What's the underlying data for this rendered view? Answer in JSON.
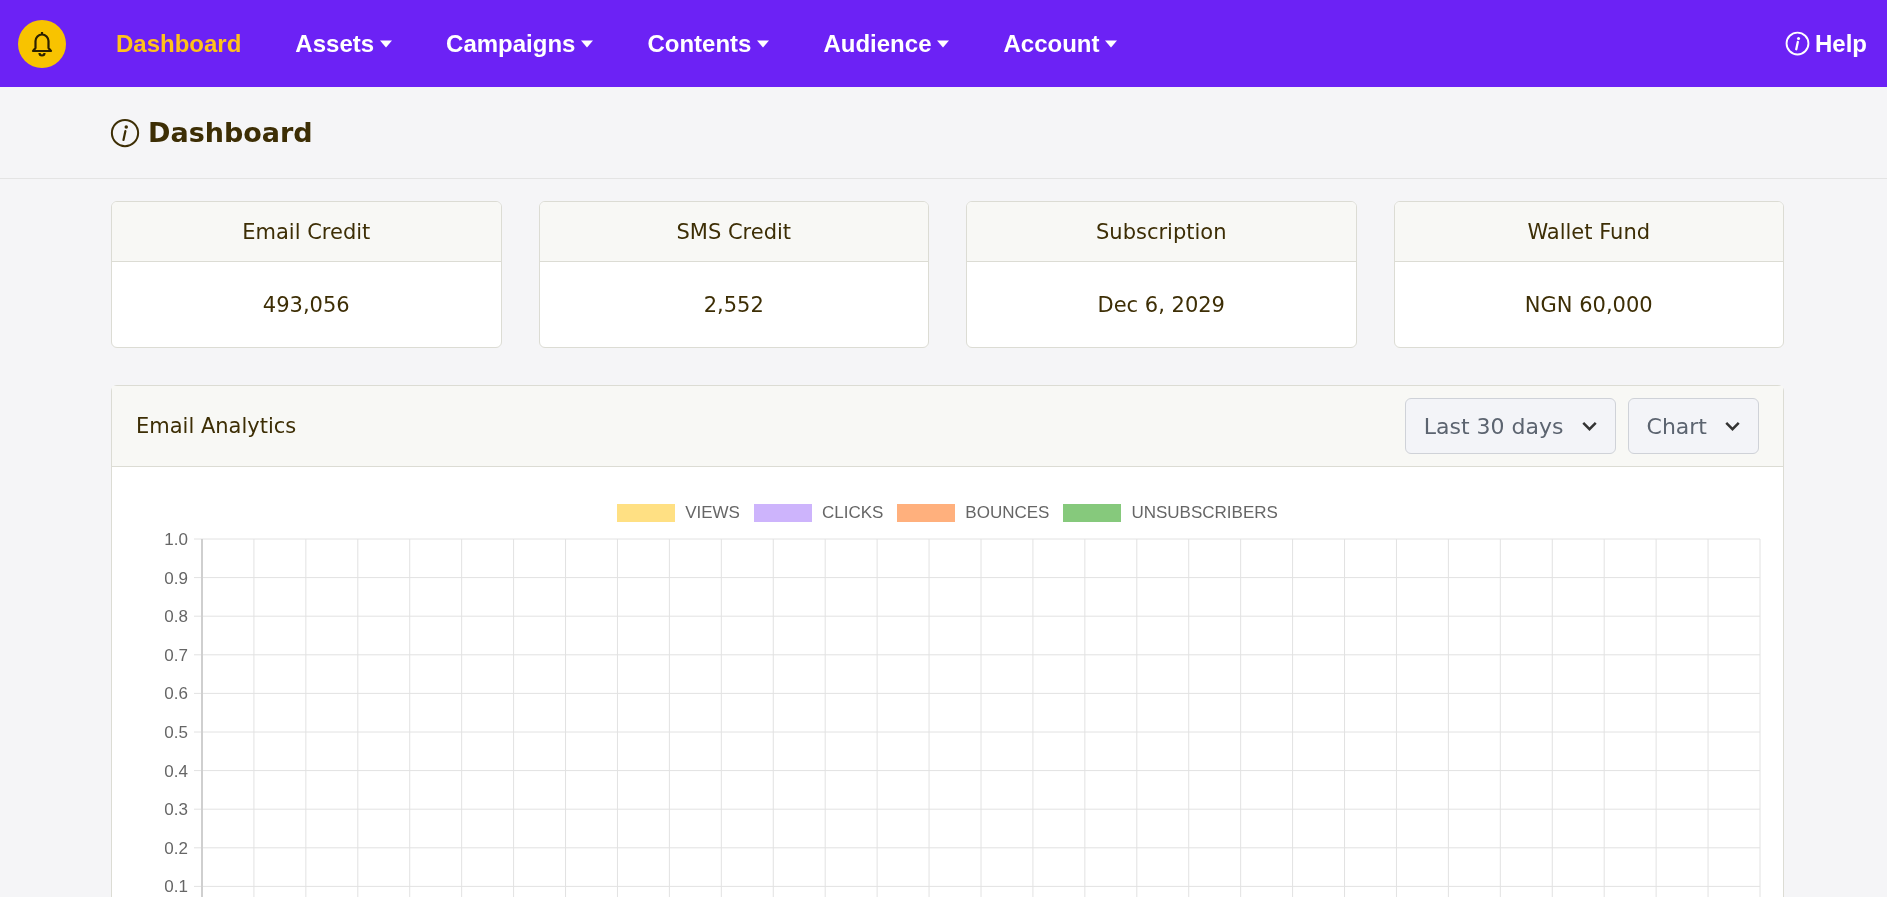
{
  "navbar": {
    "items": [
      {
        "label": "Dashboard",
        "selected": true,
        "dropdown": false
      },
      {
        "label": "Assets",
        "selected": false,
        "dropdown": true
      },
      {
        "label": "Campaigns",
        "selected": false,
        "dropdown": true
      },
      {
        "label": "Contents",
        "selected": false,
        "dropdown": true
      },
      {
        "label": "Audience",
        "selected": false,
        "dropdown": true
      },
      {
        "label": "Account",
        "selected": false,
        "dropdown": true
      }
    ],
    "help": "Help"
  },
  "page_title": "Dashboard",
  "stats": [
    {
      "label": "Email Credit",
      "value": "493,056"
    },
    {
      "label": "SMS Credit",
      "value": "2,552"
    },
    {
      "label": "Subscription",
      "value": "Dec 6, 2029"
    },
    {
      "label": "Wallet Fund",
      "value": "NGN 60,000"
    }
  ],
  "analytics": {
    "title": "Email Analytics",
    "period": "Last 30 days",
    "view": "Chart",
    "chart_data": {
      "type": "line",
      "grid": true,
      "ylim": [
        0,
        1
      ],
      "yticks": [
        {
          "value": 0.1,
          "label": "0.1"
        },
        {
          "value": 0.2,
          "label": "0.2"
        },
        {
          "value": 0.3,
          "label": "0.3"
        },
        {
          "value": 0.4,
          "label": "0.4"
        },
        {
          "value": 0.5,
          "label": "0.5"
        },
        {
          "value": 0.6,
          "label": "0.6"
        },
        {
          "value": 0.7,
          "label": "0.7"
        },
        {
          "value": 0.8,
          "label": "0.8"
        },
        {
          "value": 0.9,
          "label": "0.9"
        },
        {
          "value": 1,
          "label": "1.0"
        }
      ],
      "series": [
        {
          "name": "VIEWS",
          "color": "#ffe083"
        },
        {
          "name": "CLICKS",
          "color": "#cdb4fc"
        },
        {
          "name": "BOUNCES",
          "color": "#ffb07d"
        },
        {
          "name": "UNSUBSCRIBERS",
          "color": "#86c97c"
        }
      ]
    }
  }
}
